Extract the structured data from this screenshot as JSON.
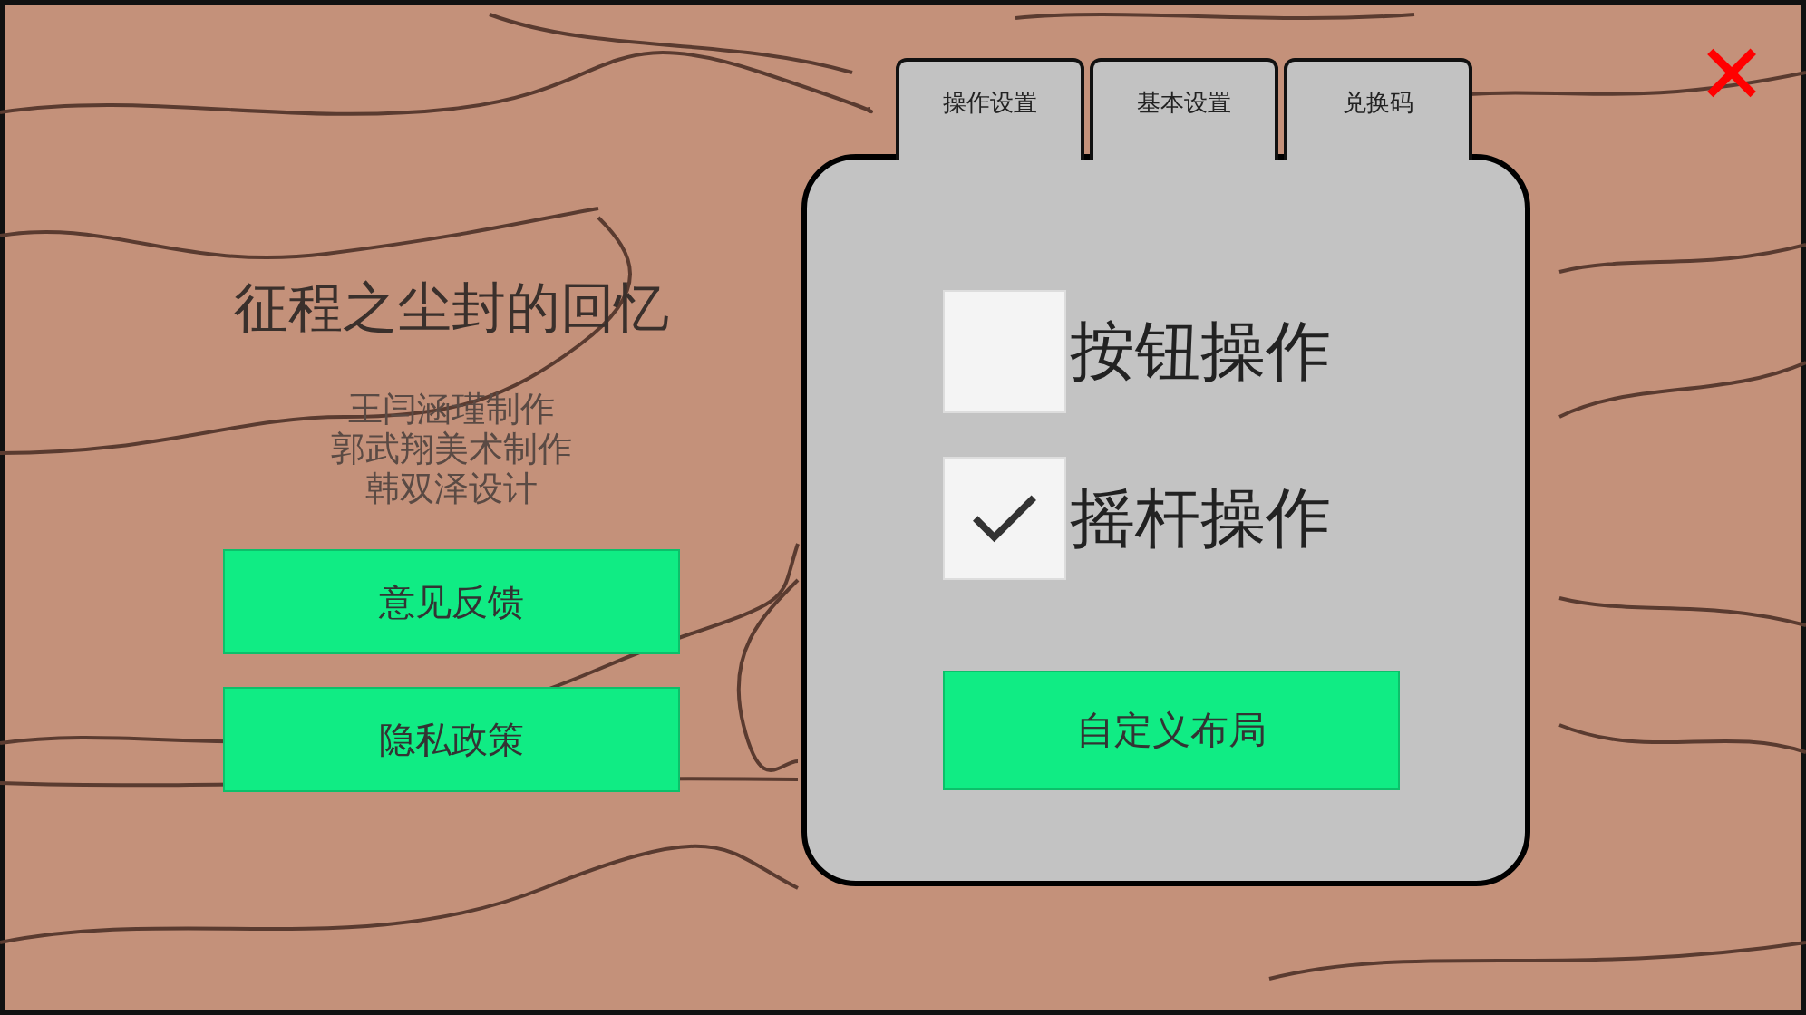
{
  "close_button": {
    "label": "✕"
  },
  "title": "征程之尘封的回忆",
  "credits": [
    "王闫涵瑾制作",
    "郭武翔美术制作",
    "韩双泽设计"
  ],
  "left_buttons": [
    "意见反馈",
    "隐私政策"
  ],
  "tabs": [
    {
      "label": "操作设置"
    },
    {
      "label": "基本设置"
    },
    {
      "label": "兑换码"
    }
  ],
  "options": [
    {
      "label": "按钮操作",
      "checked": false
    },
    {
      "label": "摇杆操作",
      "checked": true
    }
  ],
  "panel_button": "自定义布局"
}
